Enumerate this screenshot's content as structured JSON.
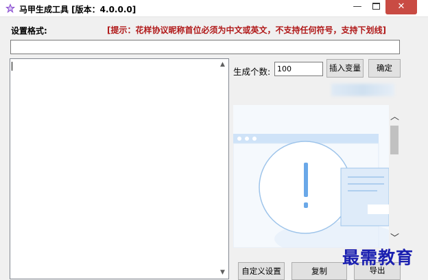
{
  "window": {
    "title": "马甲生成工具 [版本：4.0.0.0]",
    "minimize_icon": "minimize-icon",
    "maximize_icon": "maximize-icon",
    "close_icon": "close-icon"
  },
  "format": {
    "label": "设置格式:",
    "hint": "[提示：花样协议昵称首位必须为中文或英文，不支持任何符号，支持下划线]",
    "value": ""
  },
  "generate": {
    "count_label": "生成个数:",
    "count_value": "100",
    "insert_variable_button": "插入变量",
    "confirm_button": "确定"
  },
  "output": {
    "value": ""
  },
  "actions": {
    "custom_settings_button": "自定义设置",
    "copy_button": "复制",
    "export_button": "导出"
  },
  "overlay": {
    "watermark": "最需教育"
  },
  "colors": {
    "hint_red": "#b01818",
    "close_red": "#c94b43",
    "illustration_blue": "#6aa8e8"
  }
}
